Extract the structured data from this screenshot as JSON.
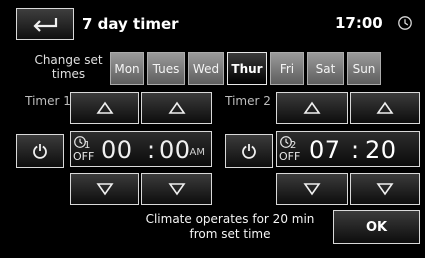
{
  "header": {
    "title": "7 day timer",
    "time": "17:00",
    "back_icon": "back-arrow-icon",
    "clock_icon": "clock-icon"
  },
  "days": {
    "label": "Change set times",
    "items": [
      {
        "label": "Mon",
        "selected": false
      },
      {
        "label": "Tues",
        "selected": false
      },
      {
        "label": "Wed",
        "selected": false
      },
      {
        "label": "Thur",
        "selected": true
      },
      {
        "label": "Fri",
        "selected": false
      },
      {
        "label": "Sat",
        "selected": false
      },
      {
        "label": "Sun",
        "selected": false
      }
    ]
  },
  "timer1": {
    "label": "Timer 1",
    "index": "1",
    "status": "OFF",
    "hours": "00",
    "separator": ":",
    "minutes": "00",
    "ampm": "AM",
    "power_icon": "power-icon"
  },
  "timer2": {
    "label": "Timer 2",
    "index": "2",
    "status": "OFF",
    "hours": "07",
    "separator": ":",
    "minutes": "20",
    "power_icon": "power-icon"
  },
  "footer": {
    "note_line1": "Climate operates for 20 min",
    "note_line2": "from set time",
    "ok_label": "OK"
  }
}
